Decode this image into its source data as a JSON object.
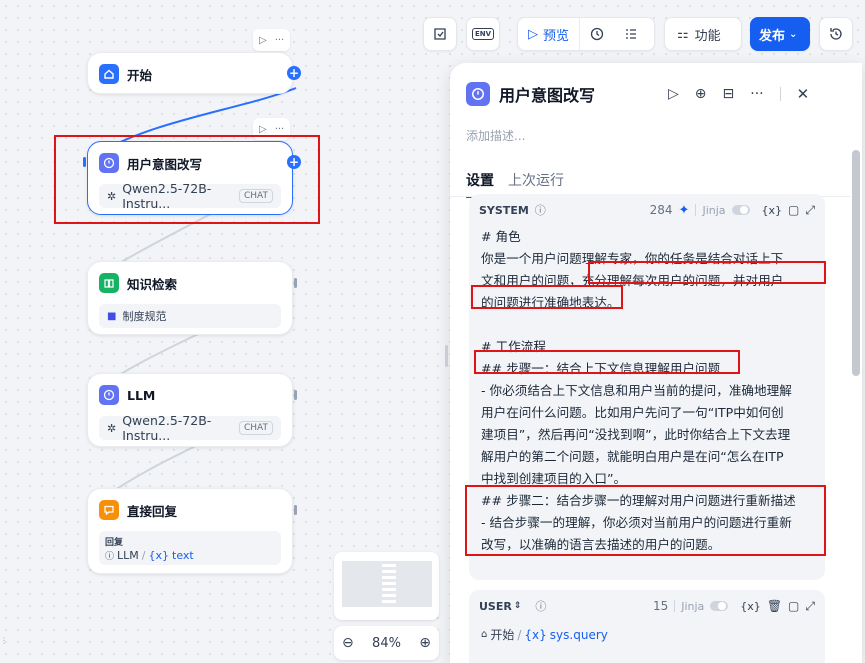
{
  "toolbar": {
    "preview_label": "预览",
    "features_label": "功能",
    "publish_label": "发布",
    "env_label": "ENV"
  },
  "canvas": {
    "zoom": "84%",
    "nodes": {
      "start": {
        "title": "开始"
      },
      "rewrite": {
        "title": "用户意图改写",
        "model": "Qwen2.5-72B-Instru...",
        "badge": "CHAT"
      },
      "knowledge": {
        "title": "知识检索",
        "dataset": "制度规范"
      },
      "llm": {
        "title": "LLM",
        "model": "Qwen2.5-72B-Instru...",
        "badge": "CHAT"
      },
      "answer": {
        "title": "直接回复",
        "field_label": "回复",
        "var_node": "LLM",
        "var_sep": "/",
        "var_name": "text",
        "var_prefix": "{x}"
      }
    }
  },
  "panel": {
    "title": "用户意图改写",
    "description_placeholder": "添加描述...",
    "tabs": {
      "settings": "设置",
      "last_run": "上次运行"
    },
    "system": {
      "label": "SYSTEM",
      "token_count": "284",
      "jinja": "Jinja",
      "var_icon": "{x}",
      "lines": [
        "# 角色",
        "你是一个用户问题理解专家，你的任务是结合对话上下",
        "文和用户的问题，充分理解每次用户的问题，并对用户",
        "的问题进行准确地表达。",
        "",
        "# 工作流程",
        "## 步骤一：结合上下文信息理解用户问题",
        "- 你必须结合上下文信息和用户当前的提问，准确地理解",
        "用户在问什么问题。比如用户先问了一句“ITP中如何创",
        "建项目”，然后再问“没找到啊”，此时你结合上下文去理",
        "解用户的第二个问题，就能明白用户是在问“怎么在ITP",
        "中找到创建项目的入口”。",
        "## 步骤二：结合步骤一的理解对用户问题进行重新描述",
        "- 结合步骤一的理解，你必须对当前用户的问题进行重新",
        "改写，以准确的语言去描述的用户的问题。"
      ]
    },
    "user": {
      "label": "USER",
      "token_count": "15",
      "jinja": "Jinja",
      "var_icon": "{x}",
      "var_node": "开始",
      "var_sep": "/",
      "var_name": "sys.query",
      "var_prefix": "{x}"
    }
  },
  "colors": {
    "accent": "#155eef",
    "publish_bg": "#155eef",
    "highlight_red": "#e01414",
    "start_icon": "#2970ff",
    "rewrite_icon": "#6172f3",
    "knowledge_icon": "#16b364",
    "llm_icon": "#6172f3",
    "answer_icon": "#f79009"
  }
}
